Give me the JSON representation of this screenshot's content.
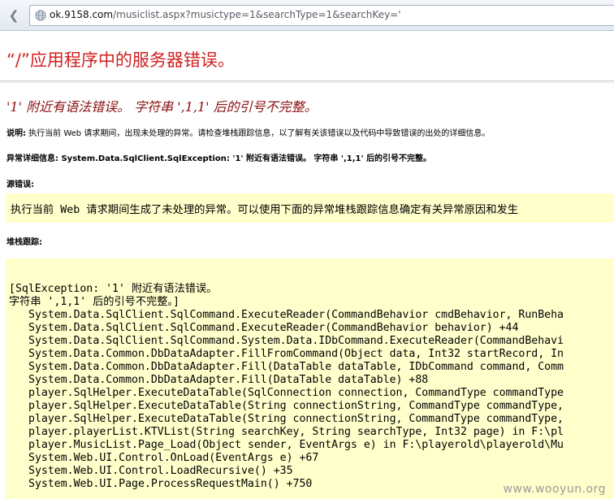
{
  "browser": {
    "url_domain": "ok.9158.com",
    "url_rest": "/musiclist.aspx?musictype=1&searchType=1&searchKey='"
  },
  "page": {
    "title": "“/”应用程序中的服务器错误。",
    "error_heading": "'1' 附近有语法错误。 字符串 ',1,1' 后的引号不完整。",
    "description_label": "说明:",
    "description_text": " 执行当前 Web 请求期间，出现未处理的异常。请检查堆栈跟踪信息，以了解有关该错误以及代码中导致错误的出处的详细信息。",
    "exception_label": "异常详细信息:",
    "exception_text": " System.Data.SqlClient.SqlException: '1' 附近有语法错误。 字符串 ',1,1' 后的引号不完整。",
    "source_error_label": "源错误:",
    "source_error_text": "执行当前 Web 请求期间生成了未处理的异常。可以使用下面的异常堆栈跟踪信息确定有关异常原因和发生",
    "stack_trace_label": "堆栈跟踪:",
    "stack_lines": [
      "[SqlException: '1' 附近有语法错误。",
      "字符串 ',1,1' 后的引号不完整。]",
      "System.Data.SqlClient.SqlCommand.ExecuteReader(CommandBehavior cmdBehavior, RunBeha",
      "System.Data.SqlClient.SqlCommand.ExecuteReader(CommandBehavior behavior) +44",
      "System.Data.SqlClient.SqlCommand.System.Data.IDbCommand.ExecuteReader(CommandBehavi",
      "System.Data.Common.DbDataAdapter.FillFromCommand(Object data, Int32 startRecord, In",
      "System.Data.Common.DbDataAdapter.Fill(DataTable dataTable, IDbCommand command, Comm",
      "System.Data.Common.DbDataAdapter.Fill(DataTable dataTable) +88",
      "player.SqlHelper.ExecuteDataTable(SqlConnection connection, CommandType commandType",
      "player.SqlHelper.ExecuteDataTable(String connectionString, CommandType commandType,",
      "player.SqlHelper.ExecuteDataTable(String connectionString, CommandType commandType,",
      "player.playerList.KTVList(String searchKey, String searchType, Int32 page) in F:\\pl",
      "player.MusicList.Page_Load(Object sender, EventArgs e) in F:\\playerold\\playerold\\Mu",
      "System.Web.UI.Control.OnLoad(EventArgs e) +67",
      "System.Web.UI.Control.LoadRecursive() +35",
      "System.Web.UI.Page.ProcessRequestMain() +750"
    ]
  },
  "watermark": "www.wooyun.org"
}
